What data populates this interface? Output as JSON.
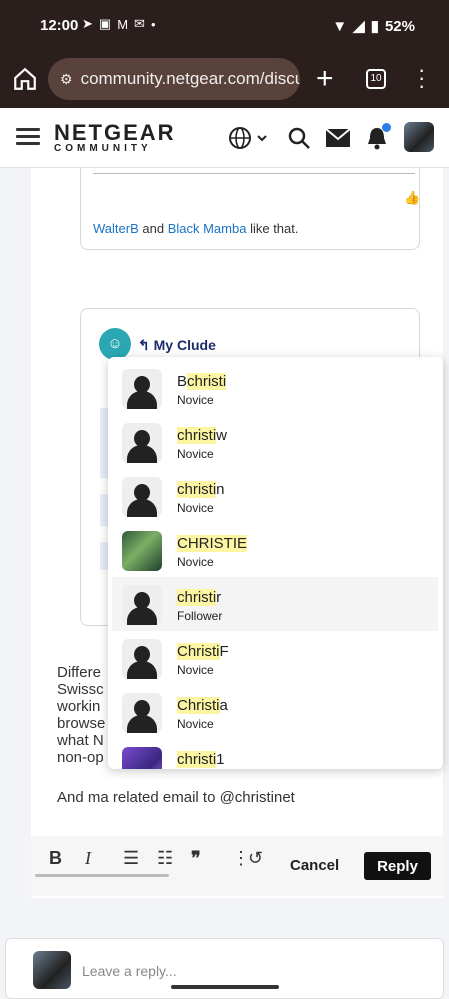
{
  "status": {
    "time": "12:00",
    "battery": "52%"
  },
  "browser": {
    "url": "community.netgear.com/discu",
    "tab_count": "10"
  },
  "header": {
    "brand": "NETGEAR",
    "sub": "COMMUNITY"
  },
  "quote1": {
    "user1": "WalterB",
    "and": "and",
    "user2": "Black Mamba",
    "tail": "like that."
  },
  "quote2": {
    "author": "My Clude"
  },
  "body_lines": [
    "Differe",
    "Swissc",
    "workin",
    "browse",
    "what N",
    "non-op"
  ],
  "email_line": "And ma related email to @christinet",
  "toolbar": {
    "cancel": "Cancel",
    "reply": "Reply"
  },
  "reply_placeholder": "Leave a reply...",
  "mentions": [
    {
      "pre": "B",
      "hl": "christi",
      "post": "",
      "rank": "Novice",
      "avatar": "default"
    },
    {
      "pre": "",
      "hl": "christi",
      "post": "w",
      "rank": "Novice",
      "avatar": "default"
    },
    {
      "pre": "",
      "hl": "christi",
      "post": "n",
      "rank": "Novice",
      "avatar": "default"
    },
    {
      "pre": "",
      "hl": "CHRISTIE",
      "post": "",
      "rank": "Novice",
      "avatar": "green"
    },
    {
      "pre": "",
      "hl": "christi",
      "post": "r",
      "rank": "Follower",
      "avatar": "default"
    },
    {
      "pre": "",
      "hl": "Christi",
      "post": "F",
      "rank": "Novice",
      "avatar": "default"
    },
    {
      "pre": "",
      "hl": "Christi",
      "post": "a",
      "rank": "Novice",
      "avatar": "default"
    },
    {
      "pre": "",
      "hl": "christi",
      "post": "1",
      "rank": "",
      "avatar": "purple"
    }
  ],
  "colors": {
    "accent": "#2b7de9",
    "highlight": "#fcf6a3",
    "chrome": "#2a1f1c"
  }
}
